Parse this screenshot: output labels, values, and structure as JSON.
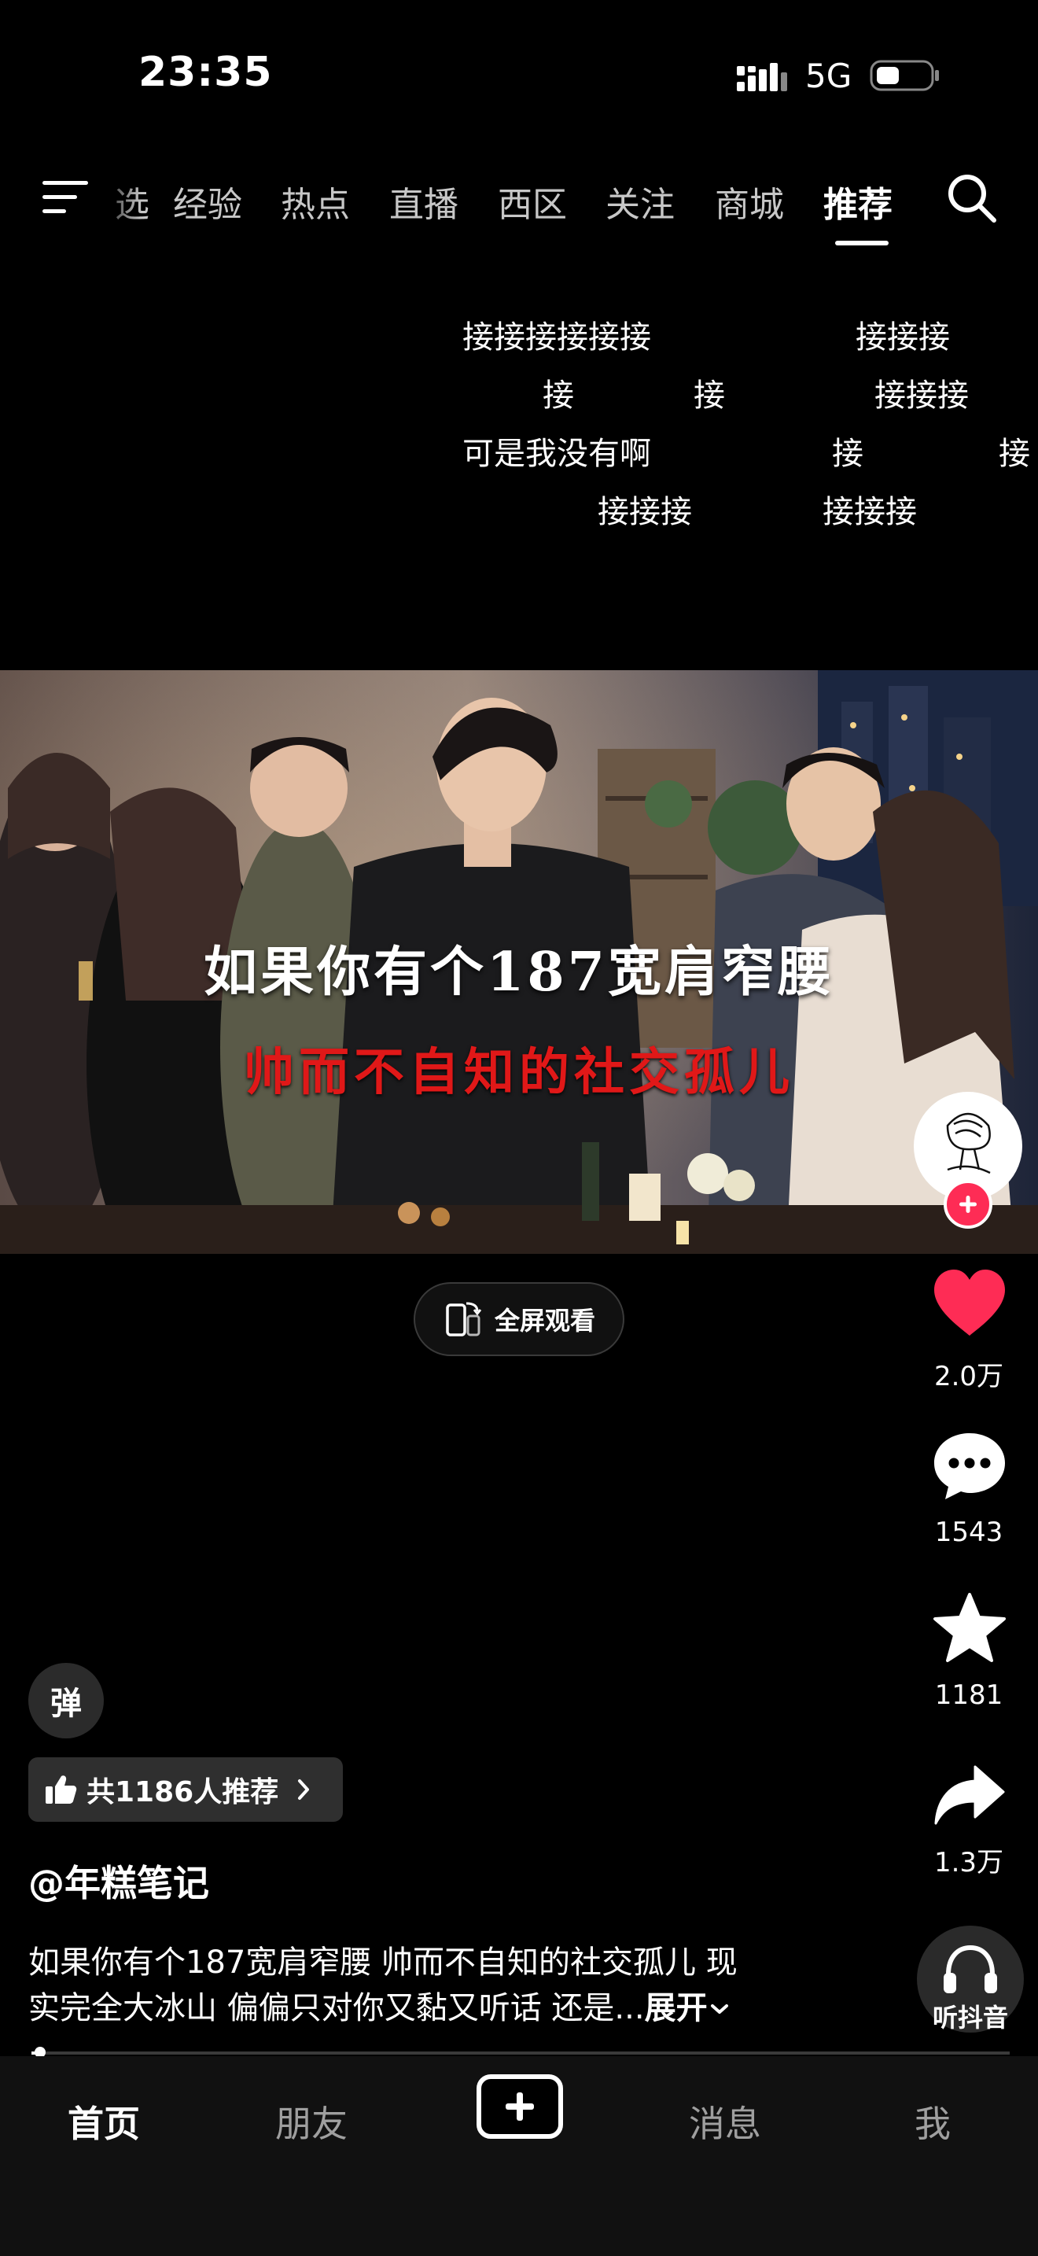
{
  "status_bar": {
    "time": "23:35",
    "network": "5G"
  },
  "top_nav": {
    "partial_tab": "选",
    "tabs": [
      "经验",
      "热点",
      "直播",
      "西区",
      "关注",
      "商城",
      "推荐"
    ],
    "active_tab": "推荐"
  },
  "danmaku": [
    "接接接接接接",
    "接接接",
    "接",
    "接",
    "接接接",
    "可是我没有啊",
    "接",
    "接",
    "接接接",
    "接接接"
  ],
  "video": {
    "caption_line1": "如果你有个187宽肩窄腰",
    "caption_line2": "帅而不自知的社交孤儿"
  },
  "fullscreen_label": "全屏观看",
  "actions": {
    "likes": "2.0万",
    "comments": "1543",
    "favorites": "1181",
    "shares": "1.3万",
    "listen_label": "听抖音"
  },
  "info": {
    "danmaku_toggle": "弹",
    "recommend_text": "共1186人推荐",
    "author": "@年糕笔记",
    "desc_line1": "如果你有个187宽肩窄腰 帅而不自知的社交孤儿 现",
    "desc_line2": "实完全大冰山 偏偏只对你又黏又听话 还是...",
    "expand_label": "展开"
  },
  "progress": {
    "fraction": 0.006
  },
  "bottom_nav": {
    "home": "首页",
    "friends": "朋友",
    "messages": "消息",
    "me": "我"
  },
  "colors": {
    "like_red": "#fe2c55",
    "caption_red": "#e01818",
    "background": "#000000"
  }
}
